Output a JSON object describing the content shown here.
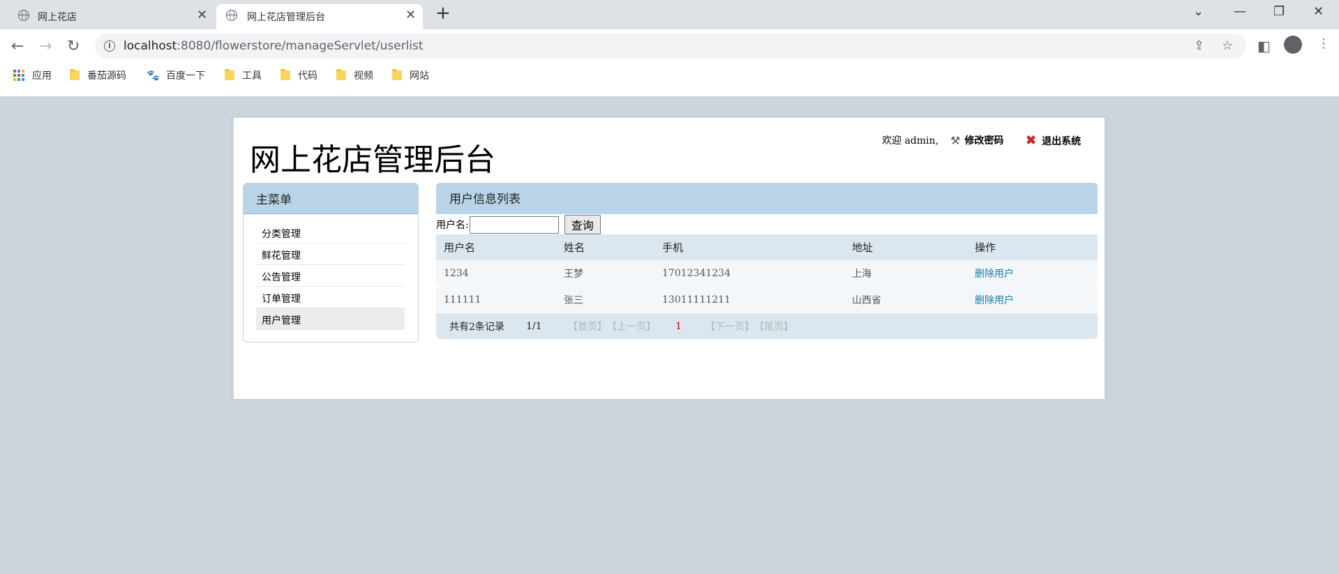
{
  "browser": {
    "tabs": [
      {
        "title": "网上花店"
      },
      {
        "title": "网上花店管理后台"
      }
    ],
    "url_host": "localhost",
    "url_path": ":8080/flowerstore/manageServlet/userlist",
    "bookmarks": [
      {
        "label": "应用",
        "icon": "apps-grid-icon"
      },
      {
        "label": "番茄源码",
        "icon": "folder-icon"
      },
      {
        "label": "百度一下",
        "icon": "baidu-paw-icon"
      },
      {
        "label": "工具",
        "icon": "folder-icon"
      },
      {
        "label": "代码",
        "icon": "folder-icon"
      },
      {
        "label": "视频",
        "icon": "folder-icon"
      },
      {
        "label": "网站",
        "icon": "folder-icon"
      }
    ]
  },
  "header": {
    "title": "网上花店管理后台",
    "welcome": "欢迎 admin,",
    "change_password": "修改密码",
    "logout": "退出系统"
  },
  "sidebar": {
    "title": "主菜单",
    "items": [
      {
        "label": "分类管理"
      },
      {
        "label": "鲜花管理"
      },
      {
        "label": "公告管理"
      },
      {
        "label": "订单管理"
      },
      {
        "label": "用户管理",
        "active": true
      }
    ]
  },
  "main": {
    "title": "用户信息列表",
    "search_label": "用户名:",
    "search_value": "",
    "search_button": "查询",
    "columns": [
      "用户名",
      "姓名",
      "手机",
      "地址",
      "操作"
    ],
    "rows": [
      {
        "username": "1234",
        "name": "王梦",
        "phone": "17012341234",
        "address": "上海",
        "action": "删除用户"
      },
      {
        "username": "111111",
        "name": "张三",
        "phone": "13011111211",
        "address": "山西省",
        "action": "删除用户"
      }
    ],
    "pager": {
      "total": "共有2条记录",
      "pages": "1/1",
      "first": "【首页】",
      "prev": "【上一页】",
      "current": "1",
      "next": "【下一页】",
      "last": "【尾页】"
    }
  },
  "colors": {
    "page_bg": "#cdd5dc",
    "header_bar": "#b8d4e6",
    "table_header": "#dbe6ee",
    "link": "#1a7ab0"
  }
}
